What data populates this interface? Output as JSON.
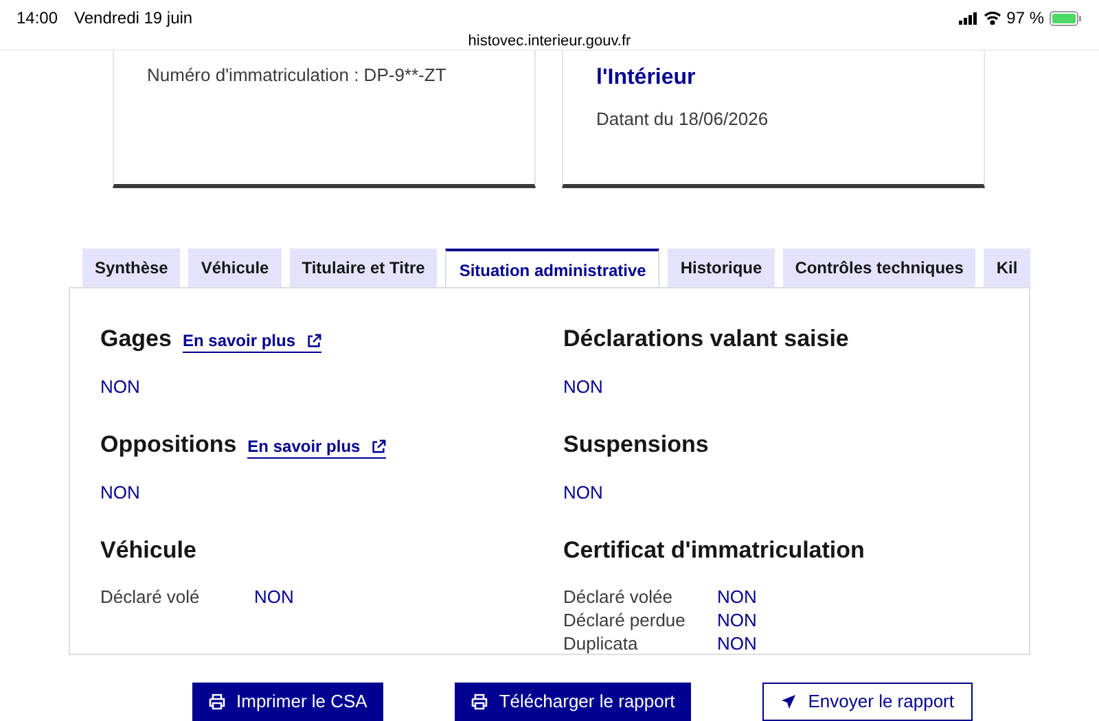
{
  "status_bar": {
    "time": "14:00",
    "date": "Vendredi 19 juin",
    "url": "histovec.interieur.gouv.fr",
    "battery": "97 %"
  },
  "cards": [
    {
      "lines": [
        {
          "kind": "text",
          "text": "Numéro d'immatriculation : DP-9**-ZT"
        }
      ]
    },
    {
      "lines": [
        {
          "kind": "title",
          "text": "l'Intérieur"
        },
        {
          "kind": "text",
          "text": "Datant du 18/06/2026"
        }
      ]
    }
  ],
  "tabs": [
    {
      "label": "Synthèse",
      "selected": false
    },
    {
      "label": "Véhicule",
      "selected": false
    },
    {
      "label": "Titulaire et Titre",
      "selected": false
    },
    {
      "label": "Situation administrative",
      "selected": true
    },
    {
      "label": "Historique",
      "selected": false
    },
    {
      "label": "Contrôles techniques",
      "selected": false
    },
    {
      "label": "Kil",
      "selected": false
    }
  ],
  "columns": [
    [
      {
        "kind": "simple",
        "title": "Gages",
        "link": "En savoir plus",
        "value": "NON"
      },
      {
        "kind": "simple",
        "title": "Oppositions",
        "link": "En savoir plus",
        "value": "NON"
      },
      {
        "kind": "rows",
        "title": "Véhicule",
        "rows": [
          {
            "label": "Déclaré volé",
            "value": "NON"
          }
        ]
      }
    ],
    [
      {
        "kind": "simple",
        "title": "Déclarations valant saisie",
        "value": "NON"
      },
      {
        "kind": "simple",
        "title": "Suspensions",
        "value": "NON"
      },
      {
        "kind": "rows",
        "title": "Certificat d'immatriculation",
        "rows": [
          {
            "label": "Déclaré volée",
            "value": "NON"
          },
          {
            "label": "Déclaré perdue",
            "value": "NON"
          },
          {
            "label": "Duplicata",
            "value": "NON"
          }
        ]
      }
    ]
  ],
  "buttons": [
    {
      "label": "Imprimer le CSA",
      "kind": "primary"
    },
    {
      "label": "Télécharger le rapport",
      "kind": "primary"
    },
    {
      "label": "Envoyer le rapport",
      "kind": "secondary"
    }
  ]
}
